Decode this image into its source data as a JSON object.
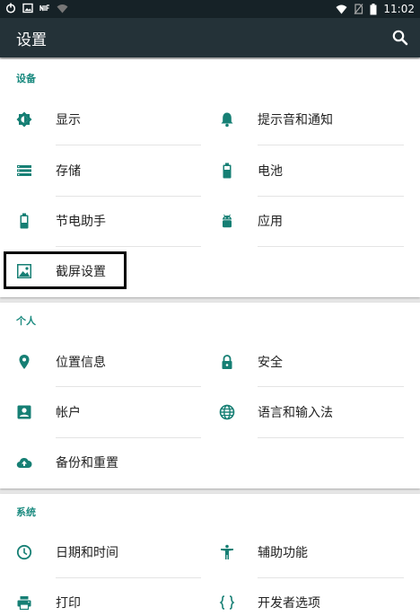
{
  "status_bar": {
    "time": "11:02",
    "icons_left": [
      "power-icon",
      "image-icon",
      "nfc-icon",
      "wifi-icon"
    ],
    "icons_right": [
      "wifi-signal-icon",
      "no-sim-icon",
      "battery-icon"
    ]
  },
  "app_bar": {
    "title": "设置",
    "search_icon": "search-icon"
  },
  "colors": {
    "accent": "#1a8a7f",
    "app_bar": "#243238",
    "status_bar": "#162227",
    "background": "#e6e6e6",
    "icon": "#167f74"
  },
  "sections": [
    {
      "header": "设备",
      "items": [
        {
          "label": "显示",
          "icon": "brightness-icon"
        },
        {
          "label": "提示音和通知",
          "icon": "bell-icon"
        },
        {
          "label": "存储",
          "icon": "storage-icon"
        },
        {
          "label": "电池",
          "icon": "battery-icon"
        },
        {
          "label": "节电助手",
          "icon": "battery-saver-icon"
        },
        {
          "label": "应用",
          "icon": "android-icon"
        },
        {
          "label": "截屏设置",
          "icon": "screenshot-icon"
        }
      ]
    },
    {
      "header": "个人",
      "items": [
        {
          "label": "位置信息",
          "icon": "location-pin-icon"
        },
        {
          "label": "安全",
          "icon": "lock-icon"
        },
        {
          "label": "帐户",
          "icon": "account-icon"
        },
        {
          "label": "语言和输入法",
          "icon": "globe-icon"
        },
        {
          "label": "备份和重置",
          "icon": "cloud-upload-icon"
        }
      ]
    },
    {
      "header": "系统",
      "items": [
        {
          "label": "日期和时间",
          "icon": "clock-icon"
        },
        {
          "label": "辅助功能",
          "icon": "accessibility-icon"
        },
        {
          "label": "打印",
          "icon": "printer-icon"
        },
        {
          "label": "开发者选项",
          "icon": "braces-icon"
        }
      ]
    }
  ]
}
